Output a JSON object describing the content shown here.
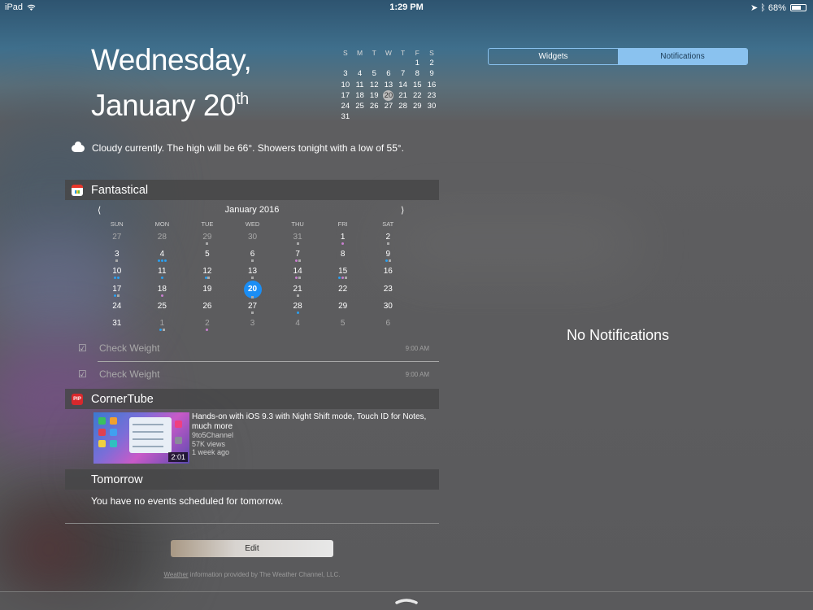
{
  "status_bar": {
    "device": "iPad",
    "time": "1:29 PM",
    "battery_text": "68%",
    "battery_level": 0.68
  },
  "date": {
    "line1": "Wednesday,",
    "line2": "January 20",
    "suffix": "th"
  },
  "mini_calendar": {
    "weekdays": [
      "S",
      "M",
      "T",
      "W",
      "T",
      "F",
      "S"
    ],
    "weeks": [
      [
        "",
        "",
        "",
        "",
        "",
        "1",
        "2"
      ],
      [
        "3",
        "4",
        "5",
        "6",
        "7",
        "8",
        "9"
      ],
      [
        "10",
        "11",
        "12",
        "13",
        "14",
        "15",
        "16"
      ],
      [
        "17",
        "18",
        "19",
        "20",
        "21",
        "22",
        "23"
      ],
      [
        "24",
        "25",
        "26",
        "27",
        "28",
        "29",
        "30"
      ],
      [
        "31",
        "",
        "",
        "",
        "",
        "",
        ""
      ]
    ],
    "today": "20"
  },
  "tabs": {
    "widgets": "Widgets",
    "notifications": "Notifications",
    "active": "notifications"
  },
  "weather": {
    "text": "Cloudy currently. The high will be 66°. Showers tonight with a low of 55°."
  },
  "fantastical": {
    "title": "Fantastical",
    "month": "January 2016",
    "prev": "⟨",
    "next": "⟩",
    "weekdays": [
      "SUN",
      "MON",
      "TUE",
      "WED",
      "THU",
      "FRI",
      "SAT"
    ],
    "weeks": [
      [
        {
          "d": "27",
          "dim": true
        },
        {
          "d": "28",
          "dim": true
        },
        {
          "d": "29",
          "dim": true,
          "m": [
            "#aaa"
          ]
        },
        {
          "d": "30",
          "dim": true
        },
        {
          "d": "31",
          "dim": true,
          "m": [
            "#aaa"
          ]
        },
        {
          "d": "1",
          "m": [
            "#c97fd0"
          ]
        },
        {
          "d": "2",
          "m": [
            "#aaa"
          ]
        }
      ],
      [
        {
          "d": "3",
          "m": [
            "#aaa"
          ]
        },
        {
          "d": "4",
          "m": [
            "#2aa0f0",
            "#2aa0f0",
            "#2aa0f0"
          ]
        },
        {
          "d": "5"
        },
        {
          "d": "6",
          "m": [
            "#aaa"
          ]
        },
        {
          "d": "7",
          "m": [
            "#c97fd0",
            "#aaa"
          ]
        },
        {
          "d": "8"
        },
        {
          "d": "9",
          "m": [
            "#2aa0f0",
            "#aaa"
          ]
        }
      ],
      [
        {
          "d": "10",
          "m": [
            "#2aa0f0",
            "#2aa0f0"
          ]
        },
        {
          "d": "11",
          "m": [
            "#2aa0f0"
          ]
        },
        {
          "d": "12",
          "m": [
            "#2aa0f0",
            "#aaa"
          ]
        },
        {
          "d": "13",
          "m": [
            "#aaa"
          ]
        },
        {
          "d": "14",
          "m": [
            "#c97fd0",
            "#aaa"
          ]
        },
        {
          "d": "15",
          "m": [
            "#2aa0f0",
            "#c97fd0",
            "#aaa"
          ]
        },
        {
          "d": "16"
        }
      ],
      [
        {
          "d": "17",
          "m": [
            "#2aa0f0",
            "#aaa"
          ]
        },
        {
          "d": "18",
          "m": [
            "#c97fd0"
          ]
        },
        {
          "d": "19"
        },
        {
          "d": "20",
          "today": true
        },
        {
          "d": "21",
          "m": [
            "#aaa"
          ]
        },
        {
          "d": "22"
        },
        {
          "d": "23"
        }
      ],
      [
        {
          "d": "24"
        },
        {
          "d": "25"
        },
        {
          "d": "26"
        },
        {
          "d": "27",
          "m": [
            "#aaa"
          ]
        },
        {
          "d": "28",
          "m": [
            "#2aa0f0"
          ]
        },
        {
          "d": "29"
        },
        {
          "d": "30"
        }
      ],
      [
        {
          "d": "31"
        },
        {
          "d": "1",
          "dim": true,
          "m": [
            "#2aa0f0",
            "#aaa"
          ]
        },
        {
          "d": "2",
          "dim": true,
          "m": [
            "#c97fd0"
          ]
        },
        {
          "d": "3",
          "dim": true
        },
        {
          "d": "4",
          "dim": true
        },
        {
          "d": "5",
          "dim": true
        },
        {
          "d": "6",
          "dim": true
        }
      ]
    ],
    "tasks": [
      {
        "title": "Check Weight",
        "time": "9:00 AM"
      },
      {
        "title": "Check Weight",
        "time": "9:00 AM"
      }
    ]
  },
  "cornertube": {
    "title": "CornerTube",
    "icon_text": "PIP",
    "video": {
      "title": "Hands-on with iOS 9.3 with Night Shift mode, Touch ID for Notes, much more",
      "channel": "9to5Channel",
      "views": "57K views",
      "age": "1 week ago",
      "duration": "2:01"
    }
  },
  "tomorrow": {
    "title": "Tomorrow",
    "text": "You have no events scheduled for tomorrow."
  },
  "edit_label": "Edit",
  "credit": {
    "link": "Weather",
    "text": " information provided by The Weather Channel, LLC."
  },
  "notifications_empty": "No Notifications"
}
